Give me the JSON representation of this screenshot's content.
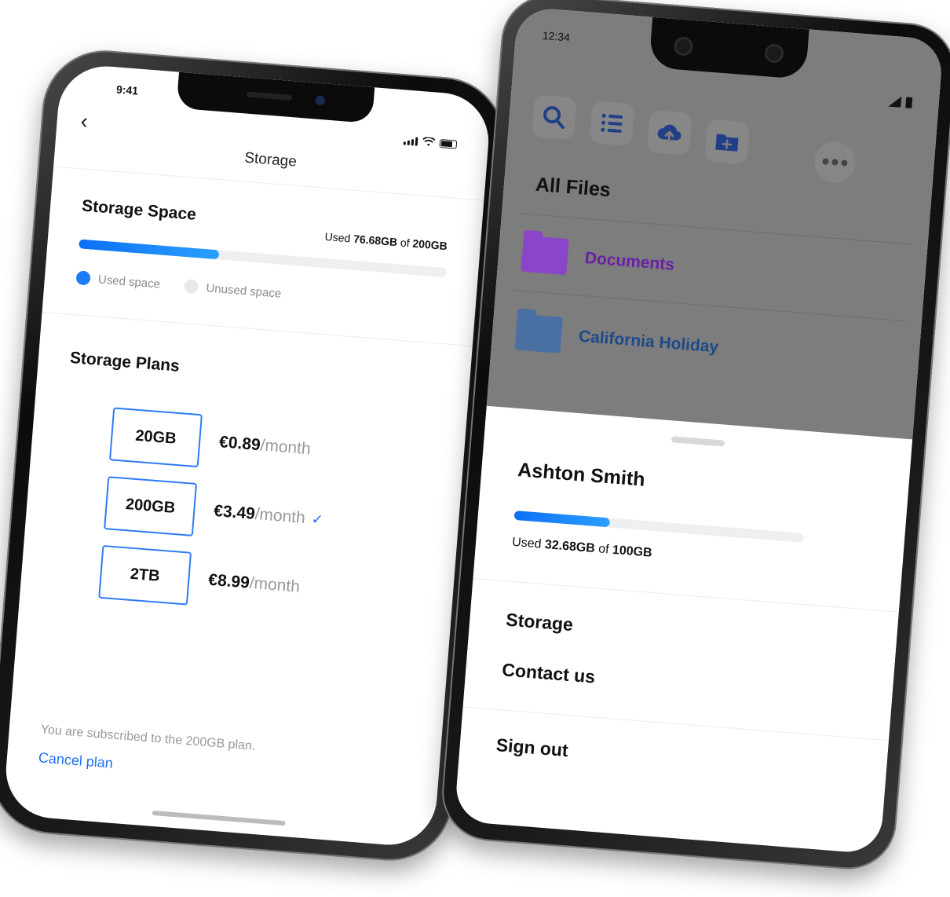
{
  "left_phone": {
    "status_time": "9:41",
    "nav_title": "Storage",
    "storage_space": {
      "title": "Storage Space",
      "used_prefix": "Used",
      "used_amount": "76.68GB",
      "of_word": "of",
      "total_amount": "200GB",
      "progress_fraction": 0.38,
      "legend_used": "Used space",
      "legend_unused": "Unused space"
    },
    "plans": {
      "title": "Storage Plans",
      "items": [
        {
          "size": "20GB",
          "price": "€0.89",
          "period": "/month",
          "selected": false
        },
        {
          "size": "200GB",
          "price": "€3.49",
          "period": "/month",
          "selected": true
        },
        {
          "size": "2TB",
          "price": "€8.99",
          "period": "/month",
          "selected": false
        }
      ]
    },
    "subscription_text": "You are subscribed to the 200GB plan.",
    "cancel_label": "Cancel plan"
  },
  "right_phone": {
    "status_time": "12:34",
    "toolbar": [
      "search-icon",
      "list-icon",
      "cloud-upload-icon",
      "new-folder-icon",
      "more-icon"
    ],
    "all_files_title": "All Files",
    "files": [
      {
        "name": "Documents",
        "color": "#8b2fd0",
        "icon": "document-folder-icon"
      },
      {
        "name": "California Holiday",
        "color": "#214a8a",
        "icon": "camera-folder-icon"
      }
    ],
    "account": {
      "name": "Ashton Smith",
      "used_prefix": "Used",
      "used_amount": "32.68GB",
      "of_word": "of",
      "total_amount": "100GB",
      "progress_fraction": 0.33
    },
    "menu": {
      "storage": "Storage",
      "contact": "Contact us",
      "sign_out": "Sign out"
    }
  },
  "colors": {
    "accent_blue": "#1f6ef5",
    "dim_overlay": "#7d7d7d"
  }
}
